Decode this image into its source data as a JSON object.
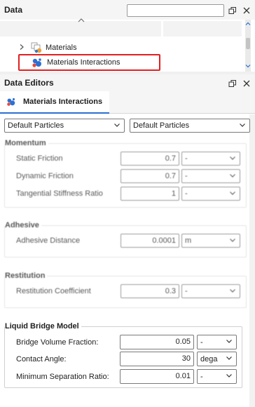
{
  "data_panel": {
    "title": "Data",
    "search_placeholder": "",
    "tree": [
      {
        "label": "Materials",
        "expanded": false
      },
      {
        "label": "Materials Interactions",
        "selected": true
      }
    ]
  },
  "editors_panel": {
    "title": "Data Editors",
    "tab_label": "Materials Interactions"
  },
  "particles": {
    "left": "Default Particles",
    "right": "Default Particles"
  },
  "momentum": {
    "title": "Momentum",
    "rows": [
      {
        "label": "Static Friction",
        "value": "0.7",
        "unit": "-"
      },
      {
        "label": "Dynamic Friction",
        "value": "0.7",
        "unit": "-"
      },
      {
        "label": "Tangential Stiffness Ratio",
        "value": "1",
        "unit": "-"
      }
    ]
  },
  "adhesive": {
    "title": "Adhesive",
    "rows": [
      {
        "label": "Adhesive Distance",
        "value": "0.0001",
        "unit": "m"
      }
    ]
  },
  "restitution": {
    "title": "Restitution",
    "rows": [
      {
        "label": "Restitution Coefficient",
        "value": "0.3",
        "unit": "-"
      }
    ]
  },
  "liquid_bridge": {
    "title": "Liquid Bridge Model",
    "rows": [
      {
        "label": "Bridge Volume Fraction:",
        "value": "0.05",
        "unit": "-"
      },
      {
        "label": "Contact Angle:",
        "value": "30",
        "unit": "dega"
      },
      {
        "label": "Minimum Separation Ratio:",
        "value": "0.01",
        "unit": "-"
      }
    ]
  },
  "colors": {
    "accent": "#2c6fd0",
    "highlight": "#e02020"
  }
}
